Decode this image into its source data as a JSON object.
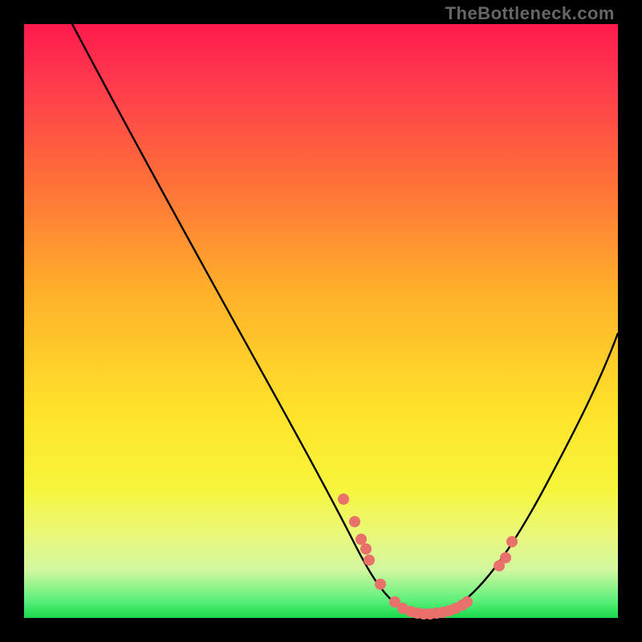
{
  "watermark": "TheBottleneck.com",
  "colors": {
    "bg": "#000000",
    "grad_top": "#ff1a4d",
    "grad_mid": "#ffe22a",
    "grad_bot": "#18d94a",
    "curve": "#000000",
    "points": "#e8716b"
  },
  "chart_data": {
    "type": "line",
    "title": "",
    "xlabel": "",
    "ylabel": "",
    "xlim": [
      0,
      100
    ],
    "ylim": [
      0,
      100
    ],
    "note": "axes unlabeled in source image; values are geometric estimates on a 0-100 normalized scale",
    "series": [
      {
        "name": "curve",
        "x": [
          8,
          15,
          25,
          35,
          45,
          52,
          56,
          60,
          64,
          68,
          72,
          76,
          80,
          86,
          92,
          100
        ],
        "y": [
          100,
          87,
          70,
          52,
          35,
          22,
          14,
          8,
          3,
          1,
          1,
          3,
          8,
          18,
          30,
          48
        ]
      }
    ],
    "scatter_overlay": {
      "name": "highlighted-points",
      "x": [
        54,
        56,
        57,
        58,
        58,
        60,
        63,
        64,
        65,
        66,
        67,
        68,
        69,
        70,
        71,
        72,
        73,
        74,
        80,
        81,
        82
      ],
      "y": [
        20,
        16,
        13,
        12,
        10,
        6,
        3,
        2,
        2,
        1,
        1,
        1,
        1,
        1,
        1,
        1,
        2,
        2,
        9,
        10,
        13
      ]
    }
  }
}
